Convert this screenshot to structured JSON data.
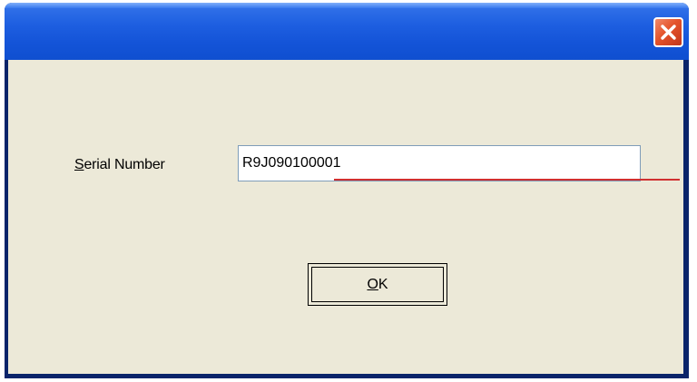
{
  "window": {
    "title": ""
  },
  "form": {
    "serial_label_accel": "S",
    "serial_label_rest": "erial Number",
    "serial_value": "R9J090100001"
  },
  "buttons": {
    "ok_accel": "O",
    "ok_rest": "K"
  },
  "icons": {
    "close": "close-icon"
  },
  "colors": {
    "titlebar": "#1454d8",
    "client": "#ece9d8",
    "close_button": "#e4532b",
    "annotation_line": "#d03030"
  }
}
